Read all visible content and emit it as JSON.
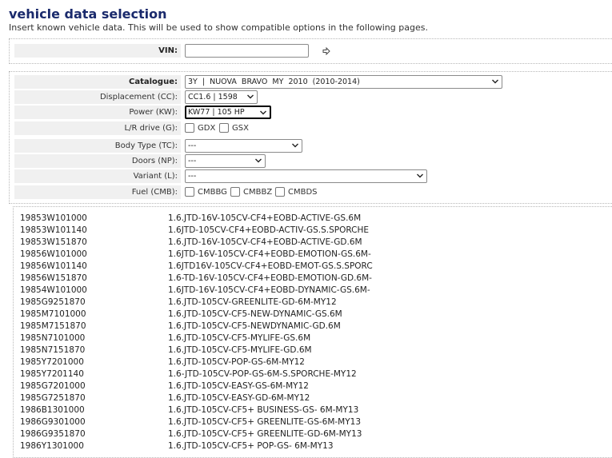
{
  "header": {
    "title": "vehicle data selection",
    "subtitle": "Insert known vehicle data. This will be used to show compatible options in the following pages."
  },
  "vin": {
    "label": "VIN:",
    "value": "",
    "go_icon": "arrow-right-icon"
  },
  "fields": {
    "catalogue": {
      "label": "Catalogue:",
      "value": "3Y  |  NUOVA  BRAVO  MY  2010  (2010-2014)"
    },
    "displacement": {
      "label": "Displacement (CC):",
      "value": "CC1.6 | 1598"
    },
    "power": {
      "label": "Power (KW):",
      "value": "KW77 | 105 HP"
    },
    "lr_drive": {
      "label": "L/R drive (G):",
      "options": [
        "GDX",
        "GSX"
      ]
    },
    "body_type": {
      "label": "Body Type (TC):",
      "value": "---"
    },
    "doors": {
      "label": "Doors (NP):",
      "value": "---"
    },
    "variant": {
      "label": "Variant (L):",
      "value": "---"
    },
    "fuel": {
      "label": "Fuel (CMB):",
      "options": [
        "CMBBG",
        "CMBBZ",
        "CMBDS"
      ]
    }
  },
  "results": [
    {
      "code": "19853W101000",
      "desc": "1.6.JTD-16V-105CV-CF4+EOBD-ACTIVE-GS.6M"
    },
    {
      "code": "19853W101140",
      "desc": "1.6JTD-105CV-CF4+EOBD-ACTIV-GS.S.SPORCHE"
    },
    {
      "code": "19853W151870",
      "desc": "1.6.JTD-16V-105CV-CF4+EOBD-ACTIVE-GD.6M"
    },
    {
      "code": "19856W101000",
      "desc": "1.6JTD-16V-105CV-CF4+EOBD-EMOTION-GS.6M-"
    },
    {
      "code": "19856W101140",
      "desc": "1.6JTD16V-105CV-CF4+EOBD-EMOT-GS.S.SPORC"
    },
    {
      "code": "19856W151870",
      "desc": "1.6-TD-16V-105CV-CF4+EOBD-EMOTION-GD.6M-"
    },
    {
      "code": "19854W101000",
      "desc": "1.6JTD-16V-105CV-CF4+EOBD-DYNAMIC-GS.6M-"
    },
    {
      "code": "1985G9251870",
      "desc": "1.6.JTD-105CV-GREENLITE-GD-6M-MY12"
    },
    {
      "code": "1985M7101000",
      "desc": "1.6.JTD-105CV-CF5-NEW-DYNAMIC-GS.6M"
    },
    {
      "code": "1985M7151870",
      "desc": "1.6.JTD-105CV-CF5-NEWDYNAMIC-GD.6M"
    },
    {
      "code": "1985N7101000",
      "desc": "1.6.JTD-105CV-CF5-MYLIFE-GS.6M"
    },
    {
      "code": "1985N7151870",
      "desc": "1.6.JTD-105CV-CF5-MYLIFE-GD.6M"
    },
    {
      "code": "1985Y7201000",
      "desc": "1.6.JTD-105CV-POP-GS-6M-MY12"
    },
    {
      "code": "1985Y7201140",
      "desc": "1.6-JTD-105CV-POP-GS-6M-S.SPORCHE-MY12"
    },
    {
      "code": "1985G7201000",
      "desc": "1.6.JTD-105CV-EASY-GS-6M-MY12"
    },
    {
      "code": "1985G7251870",
      "desc": "1.6.JTD-105CV-EASY-GD-6M-MY12"
    },
    {
      "code": "1986B1301000",
      "desc": "1.6.JTD-105CV-CF5+ BUSINESS-GS- 6M-MY13"
    },
    {
      "code": "1986G9301000",
      "desc": "1.6.JTD-105CV-CF5+ GREENLITE-GS-6M-MY13"
    },
    {
      "code": "1986G9351870",
      "desc": "1.6.JTD-105CV-CF5+ GREENLITE-GD-6M-MY13"
    },
    {
      "code": "1986Y1301000",
      "desc": "1.6.JTD-105CV-CF5+ POP-GS- 6M-MY13"
    }
  ]
}
